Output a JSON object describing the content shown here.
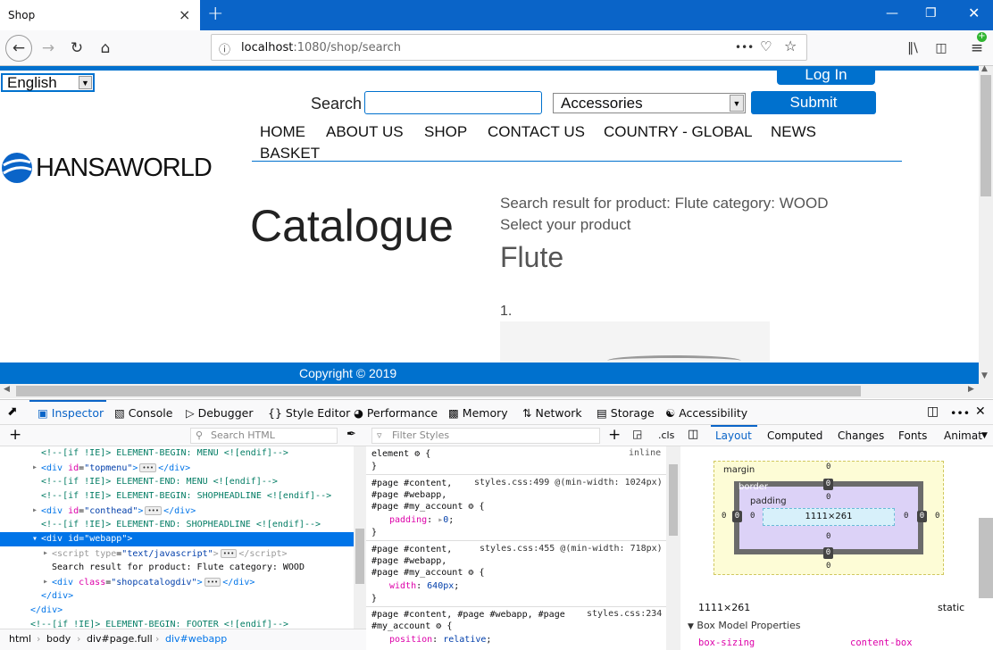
{
  "browser": {
    "tab_title": "Shop",
    "close_tab": "×",
    "new_tab": "+",
    "url_host": "localhost",
    "url_path": ":1080/shop/search",
    "page_actions": "•••"
  },
  "page": {
    "language": "English",
    "login": "Log In",
    "search_label": "Search",
    "search_value": "",
    "category": "Accessories",
    "submit": "Submit",
    "logo_text": "HANSAWORLD",
    "menu": [
      "HOME",
      "ABOUT US",
      "SHOP",
      "CONTACT US",
      "COUNTRY - GLOBAL",
      "NEWS",
      "BASKET"
    ],
    "heading": "Catalogue",
    "result_line": "Search result for product: Flute category: WOOD",
    "select_line": "Select your product",
    "product_title": "Flute",
    "list_number": "1.",
    "footer": "Copyright © 2019"
  },
  "devtools": {
    "tabs": [
      "Inspector",
      "Console",
      "Debugger",
      "Style Editor",
      "Performance",
      "Memory",
      "Network",
      "Storage",
      "Accessibility"
    ],
    "search_html_placeholder": "Search HTML",
    "filter_styles_placeholder": "Filter Styles",
    "cls": ".cls",
    "tree": [
      {
        "type": "comment",
        "text": "<!--[if !IE]> ELEMENT-BEGIN: MENU <![endif]-->"
      },
      {
        "type": "node",
        "tag": "div",
        "attr": "id",
        "val": "topmenu",
        "collapsed": true
      },
      {
        "type": "comment",
        "text": "<!--[if !IE]> ELEMENT-END: MENU <![endif]-->"
      },
      {
        "type": "comment",
        "text": "<!--[if !IE]> ELEMENT-BEGIN: SHOPHEADLINE <![endif]-->"
      },
      {
        "type": "node",
        "tag": "div",
        "attr": "id",
        "val": "conthead",
        "collapsed": true
      },
      {
        "type": "comment",
        "text": "<!--[if !IE]> ELEMENT-END: SHOPHEADLINE <![endif]-->"
      },
      {
        "type": "open",
        "tag": "div",
        "attr": "id",
        "val": "webapp",
        "selected": true
      },
      {
        "type": "node",
        "tag": "script",
        "attr": "type",
        "val": "text/javascript",
        "collapsed": true,
        "script": true
      },
      {
        "type": "text",
        "text": "Search result for product: Flute category: WOOD"
      },
      {
        "type": "node",
        "tag": "div",
        "attr": "class",
        "val": "shopcatalogdiv",
        "collapsed": true
      },
      {
        "type": "close",
        "tag": "div"
      },
      {
        "type": "close",
        "tag": "div"
      },
      {
        "type": "comment",
        "text": "<!--[if !IE]> ELEMENT-BEGIN: FOOTER <![endif]-->"
      }
    ],
    "breadcrumbs": [
      "html",
      "body",
      "div#page.full",
      "div#webapp"
    ],
    "rules": {
      "element": {
        "selector": "element",
        "brace": "{",
        "close": "}",
        "source": "inline"
      },
      "r1": {
        "selectors": [
          "#page #content,",
          "#page #webapp,",
          "#page #my_account"
        ],
        "source": "styles.css:499 @(min-width: 1024px)",
        "prop": "padding",
        "value": "0"
      },
      "r2": {
        "selectors": [
          "#page #content,",
          "#page #webapp,",
          "#page #my_account"
        ],
        "source": "styles.css:455 @(min-width: 718px)",
        "prop": "width",
        "value": "640px"
      },
      "r3": {
        "selectors": [
          "#page #content, #page #webapp, #page",
          "#my_account"
        ],
        "source": "styles.css:234",
        "prop": "position",
        "value": "relative"
      }
    },
    "layout_tabs": [
      "Layout",
      "Computed",
      "Changes",
      "Fonts",
      "Animat"
    ],
    "box_model": {
      "margin_label": "margin",
      "border_label": "border",
      "padding_label": "padding",
      "content": "1111×261",
      "margin": {
        "top": "0",
        "right": "0",
        "bottom": "0",
        "left": "0"
      },
      "border": {
        "top": "0",
        "right": "0",
        "bottom": "0",
        "left": "0"
      },
      "padding": {
        "top": "0",
        "right": "0",
        "bottom": "0",
        "left": "0"
      },
      "dimensions": "1111×261",
      "position": "static"
    },
    "box_model_properties": "Box Model Properties",
    "box_sizing_prop": "box-sizing",
    "box_sizing_val": "content-box"
  },
  "colors": {
    "brand": "#0071ce",
    "chrome": "#0a64c8"
  }
}
